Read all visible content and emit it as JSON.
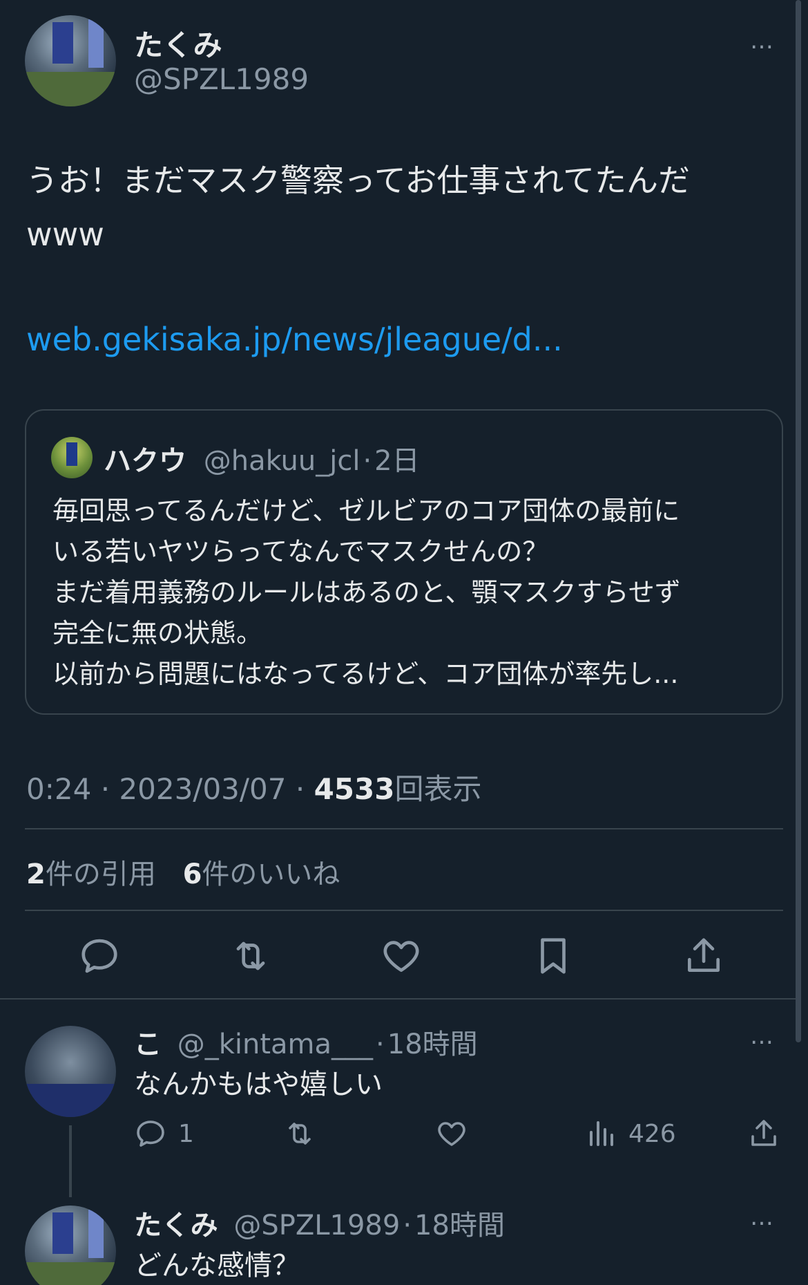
{
  "tweet": {
    "author_name": "たくみ",
    "author_handle": "@SPZL1989",
    "text_line1": "うお！まだマスク警察ってお仕事されてたんだ",
    "text_line2": "www",
    "link": "web.gekisaka.jp/news/jleague/d...",
    "time": "0:24",
    "date": "2023/03/07",
    "views_count": "4533",
    "views_label": "回表示",
    "quotes_count": "2",
    "quotes_label": "件の引用",
    "likes_count": "6",
    "likes_label": "件のいいね",
    "more_icon": "…"
  },
  "quote": {
    "name": "ハクウ",
    "handle": "@hakuu_jcl",
    "age": "2日",
    "lines": [
      "毎回思ってるんだけど、ゼルビアのコア団体の最前に",
      "いる若いヤツらってなんでマスクせんの？",
      "まだ着用義務のルールはあるのと、顎マスクすらせず",
      "完全に無の状態。",
      "以前から問題にはなってるけど、コア団体が率先し..."
    ]
  },
  "actions": [
    "reply-icon",
    "retweet-icon",
    "like-icon",
    "bookmark-icon",
    "share-icon"
  ],
  "replies": [
    {
      "name": "こ",
      "handle": "@_kintama___",
      "age": "18時間",
      "text": "なんかもはや嬉しい",
      "reply_count": "1",
      "views": "426"
    },
    {
      "name": "たくみ",
      "handle": "@SPZL1989",
      "age": "18時間",
      "text": "どんな感情？"
    }
  ],
  "separator": "·",
  "colors": {
    "background": "#15202b",
    "text": "#e7e9ea",
    "secondary": "#8b98a5",
    "link": "#1d9bf0",
    "border": "#38444d"
  }
}
